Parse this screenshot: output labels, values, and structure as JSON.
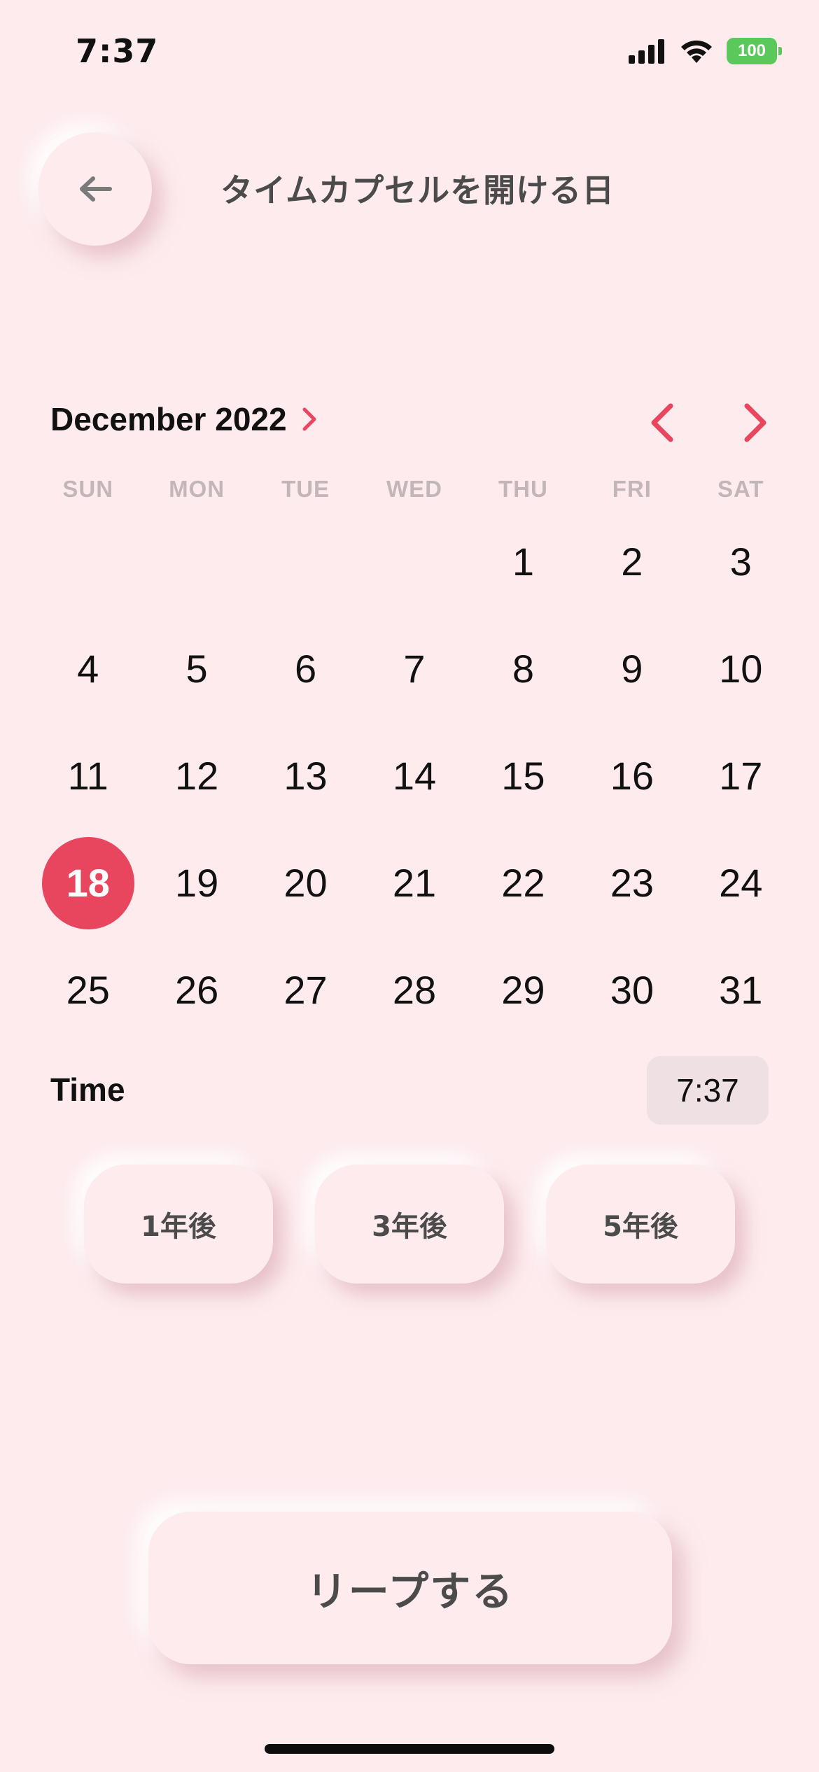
{
  "status_bar": {
    "time": "7:37",
    "battery": "100"
  },
  "header": {
    "title": "タイムカプセルを開ける日"
  },
  "calendar": {
    "month_label": "December 2022",
    "weekdays": [
      "SUN",
      "MON",
      "TUE",
      "WED",
      "THU",
      "FRI",
      "SAT"
    ],
    "days": [
      "",
      "",
      "",
      "",
      "1",
      "2",
      "3",
      "4",
      "5",
      "6",
      "7",
      "8",
      "9",
      "10",
      "11",
      "12",
      "13",
      "14",
      "15",
      "16",
      "17",
      "18",
      "19",
      "20",
      "21",
      "22",
      "23",
      "24",
      "25",
      "26",
      "27",
      "28",
      "29",
      "30",
      "31"
    ],
    "selected_day": "18"
  },
  "time": {
    "label": "Time",
    "value": "7:37"
  },
  "quick_options": [
    {
      "label": "1年後"
    },
    {
      "label": "3年後"
    },
    {
      "label": "5年後"
    }
  ],
  "submit": {
    "label": "リープする"
  },
  "colors": {
    "background": "#fdebee",
    "accent": "#e8455e",
    "text_muted": "#4b4b4b",
    "weekday": "#c3b6b9",
    "battery": "#5ac85a"
  },
  "icons": {
    "back": "arrow-left-icon",
    "month_expand": "chevron-right-icon",
    "prev_month": "chevron-left-icon",
    "next_month": "chevron-right-icon",
    "signal": "cellular-signal-icon",
    "wifi": "wifi-icon",
    "battery": "battery-charging-icon"
  }
}
